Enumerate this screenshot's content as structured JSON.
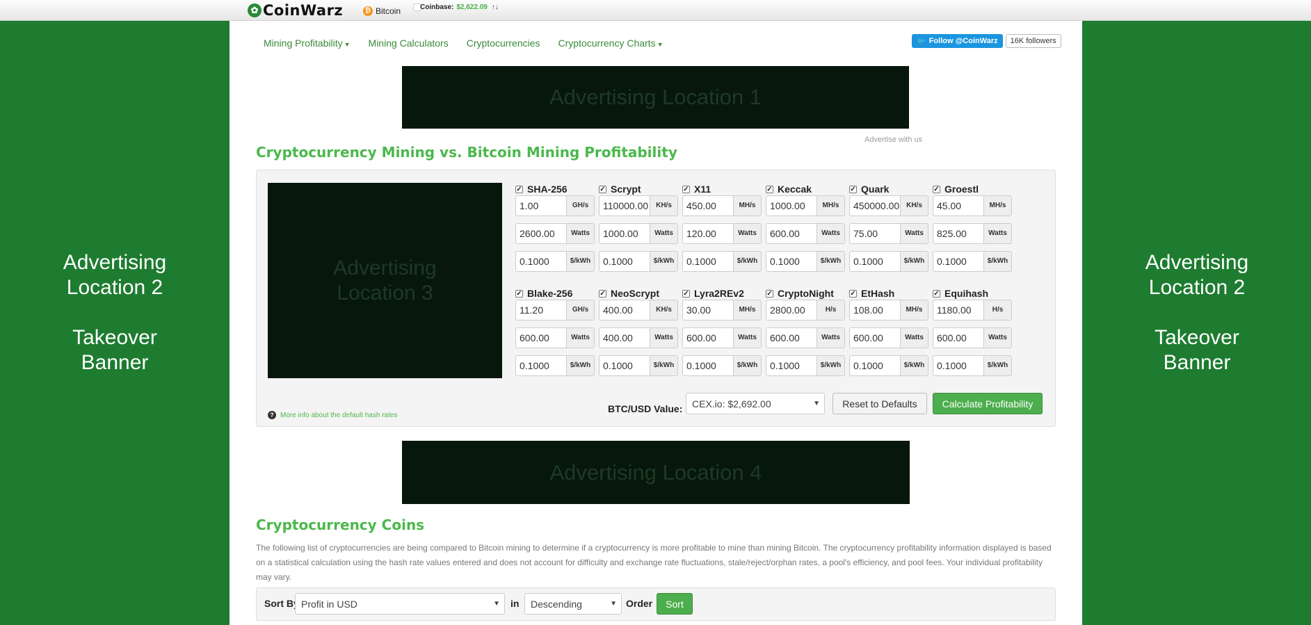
{
  "topbar": {
    "logo_text": "CoinWarz",
    "bitcoin_label": "Bitcoin",
    "coinbase_label": "Coinbase:",
    "coinbase_price": "$2,622.09",
    "price_arrows": "↑↓"
  },
  "nav": {
    "items": [
      "Mining Profitability",
      "Mining Calculators",
      "Cryptocurrencies",
      "Cryptocurrency Charts"
    ]
  },
  "twitter": {
    "follow_label": "Follow @CoinWarz",
    "followers": "16K followers"
  },
  "ads": {
    "location1": "Advertising Location 1",
    "location2_line1": "Advertising",
    "location2_line2": "Location 2",
    "location2_line3": "Takeover",
    "location2_line4": "Banner",
    "location3_line1": "Advertising",
    "location3_line2": "Location 3",
    "location4": "Advertising Location 4",
    "advertise_with_us": "Advertise with us"
  },
  "calculator": {
    "title": "Cryptocurrency Mining vs. Bitcoin Mining Profitability",
    "algorithms": [
      {
        "name": "SHA-256",
        "hash": "1.00",
        "hash_unit": "GH/s",
        "power": "2600.00",
        "power_unit": "Watts",
        "cost": "0.1000",
        "cost_unit": "$/kWh"
      },
      {
        "name": "Scrypt",
        "hash": "110000.00",
        "hash_unit": "KH/s",
        "power": "1000.00",
        "power_unit": "Watts",
        "cost": "0.1000",
        "cost_unit": "$/kWh"
      },
      {
        "name": "X11",
        "hash": "450.00",
        "hash_unit": "MH/s",
        "power": "120.00",
        "power_unit": "Watts",
        "cost": "0.1000",
        "cost_unit": "$/kWh"
      },
      {
        "name": "Keccak",
        "hash": "1000.00",
        "hash_unit": "MH/s",
        "power": "600.00",
        "power_unit": "Watts",
        "cost": "0.1000",
        "cost_unit": "$/kWh"
      },
      {
        "name": "Quark",
        "hash": "450000.00",
        "hash_unit": "KH/s",
        "power": "75.00",
        "power_unit": "Watts",
        "cost": "0.1000",
        "cost_unit": "$/kWh"
      },
      {
        "name": "Groestl",
        "hash": "45.00",
        "hash_unit": "MH/s",
        "power": "825.00",
        "power_unit": "Watts",
        "cost": "0.1000",
        "cost_unit": "$/kWh"
      },
      {
        "name": "Blake-256",
        "hash": "11.20",
        "hash_unit": "GH/s",
        "power": "600.00",
        "power_unit": "Watts",
        "cost": "0.1000",
        "cost_unit": "$/kWh"
      },
      {
        "name": "NeoScrypt",
        "hash": "400.00",
        "hash_unit": "KH/s",
        "power": "400.00",
        "power_unit": "Watts",
        "cost": "0.1000",
        "cost_unit": "$/kWh"
      },
      {
        "name": "Lyra2REv2",
        "hash": "30.00",
        "hash_unit": "MH/s",
        "power": "600.00",
        "power_unit": "Watts",
        "cost": "0.1000",
        "cost_unit": "$/kWh"
      },
      {
        "name": "CryptoNight",
        "hash": "2800.00",
        "hash_unit": "H/s",
        "power": "600.00",
        "power_unit": "Watts",
        "cost": "0.1000",
        "cost_unit": "$/kWh"
      },
      {
        "name": "EtHash",
        "hash": "108.00",
        "hash_unit": "MH/s",
        "power": "600.00",
        "power_unit": "Watts",
        "cost": "0.1000",
        "cost_unit": "$/kWh"
      },
      {
        "name": "Equihash",
        "hash": "1180.00",
        "hash_unit": "H/s",
        "power": "600.00",
        "power_unit": "Watts",
        "cost": "0.1000",
        "cost_unit": "$/kWh"
      }
    ],
    "btc_usd_label": "BTC/USD Value:",
    "btc_usd_selected": "CEX.io: $2,692.00",
    "reset_label": "Reset to Defaults",
    "calculate_label": "Calculate Profitability",
    "more_info": "More info about the default hash rates"
  },
  "coins": {
    "title": "Cryptocurrency Coins",
    "intro": "The following list of cryptocurrencies are being compared to Bitcoin mining to determine if a cryptocurrency is more profitable to mine than mining Bitcoin. The cryptocurrency profitability information displayed is based on a statistical calculation using the hash rate values entered and does not account for difficulty and exchange rate fluctuations, stale/reject/orphan rates, a pool's efficiency, and pool fees. Your individual profitability may vary.",
    "sort_by_label": "Sort By",
    "sort_by_value": "Profit in USD",
    "in_label": "in",
    "order_value": "Descending",
    "order_label": "Order",
    "sort_button": "Sort"
  }
}
